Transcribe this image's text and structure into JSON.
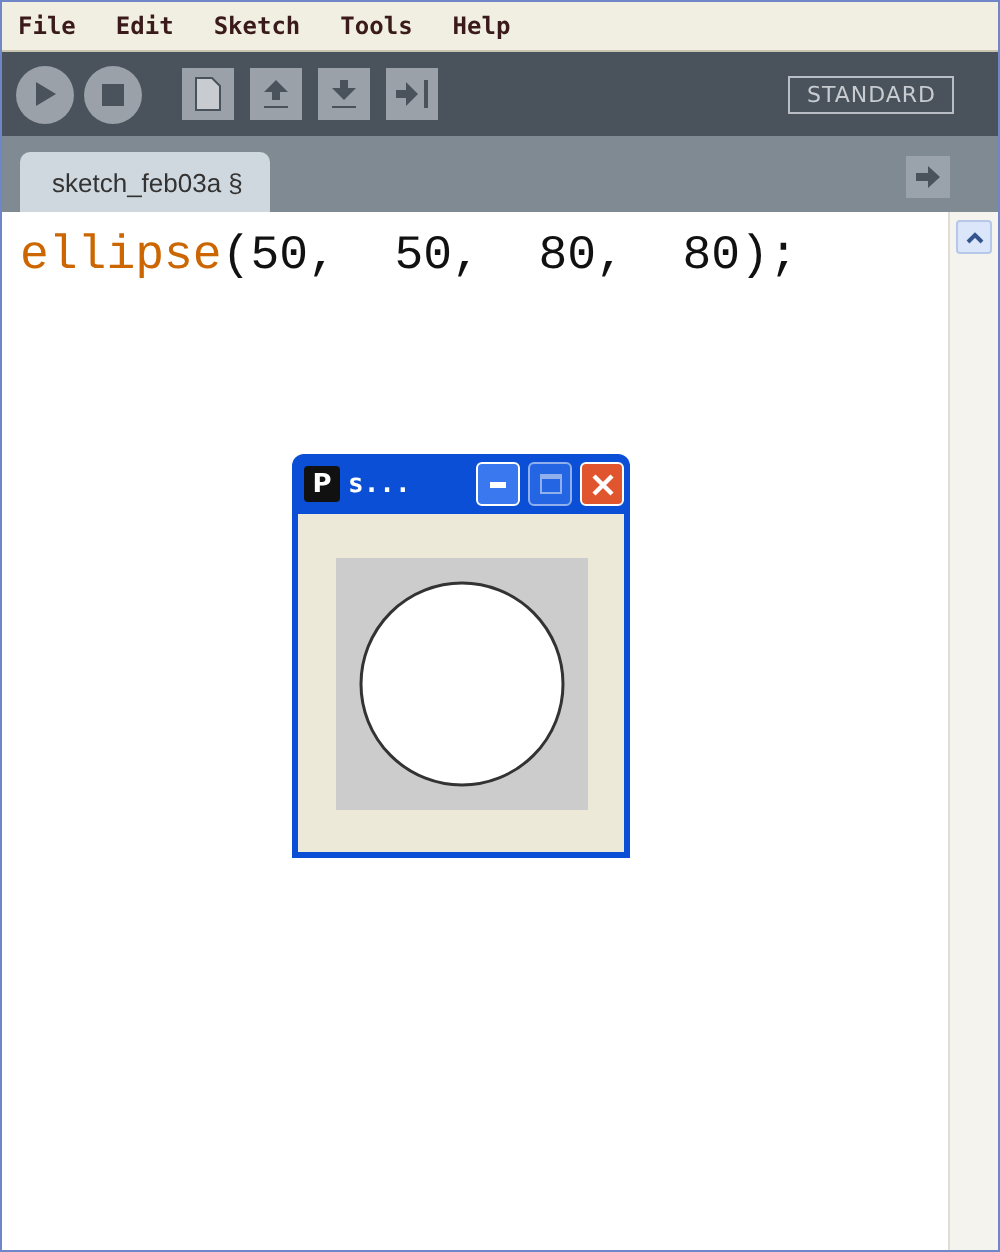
{
  "menu": [
    "File",
    "Edit",
    "Sketch",
    "Tools",
    "Help"
  ],
  "toolbar": {
    "buttons": [
      {
        "kind": "run"
      },
      {
        "kind": "stop"
      },
      {
        "kind": "new"
      },
      {
        "kind": "open"
      },
      {
        "kind": "save"
      },
      {
        "kind": "export"
      }
    ],
    "mode": "STANDARD"
  },
  "tabs": [
    {
      "label": "sketch_feb03a §",
      "selected": true
    }
  ],
  "editor": {
    "lines": [
      {
        "tokens": [
          {
            "text": "ellipse",
            "kind": "keyword"
          },
          {
            "text": "(50,  50,  80,  80);",
            "kind": "plain"
          }
        ]
      }
    ]
  },
  "sketch_window": {
    "icon_letter": "P",
    "title": "s...",
    "maximize_disabled": true
  }
}
